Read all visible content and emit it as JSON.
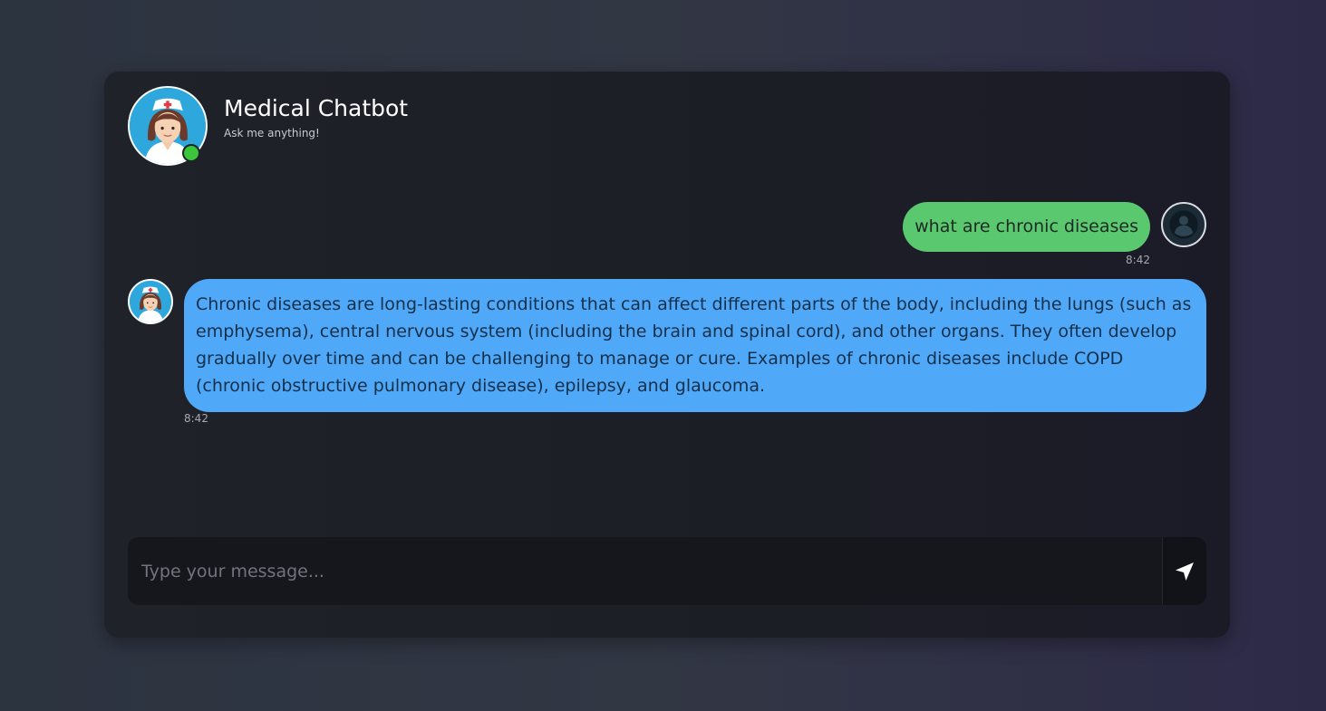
{
  "header": {
    "title": "Medical Chatbot",
    "subtitle": "Ask me anything!",
    "bot_avatar_icon": "nurse-avatar-icon",
    "status": "online"
  },
  "messages": [
    {
      "sender": "user",
      "text": "what are chronic diseases",
      "time": "8:42"
    },
    {
      "sender": "bot",
      "text": "Chronic diseases are long-lasting conditions that can affect different parts of the body, including the lungs (such as emphysema), central nervous system (including the brain and spinal cord), and other organs. They often develop gradually over time and can be challenging to manage or cure. Examples of chronic diseases include COPD (chronic obstructive pulmonary disease), epilepsy, and glaucoma.",
      "time": "8:42"
    }
  ],
  "input": {
    "placeholder": "Type your message...",
    "value": "",
    "send_icon": "send-arrow-icon"
  },
  "colors": {
    "user_bubble": "#5ac86f",
    "bot_bubble": "#4fa8f8",
    "online": "#3bc53b",
    "card": "#1f2229"
  }
}
